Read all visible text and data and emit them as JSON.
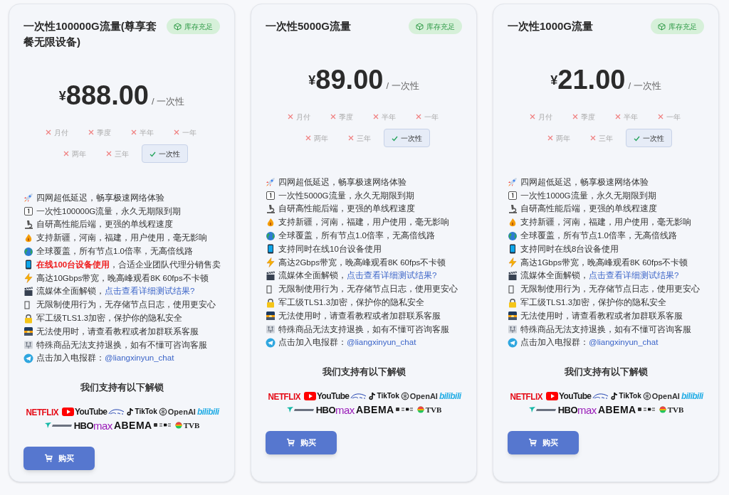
{
  "plans": [
    {
      "title": "一次性100000G流量(尊享套餐无限设备)",
      "stock_badge": "库存充足",
      "currency": "¥",
      "price": "888.00",
      "period_suffix": "/ 一次性",
      "cycles": [
        {
          "label": "月付",
          "selected": false
        },
        {
          "label": "季度",
          "selected": false
        },
        {
          "label": "半年",
          "selected": false
        },
        {
          "label": "一年",
          "selected": false
        },
        {
          "label": "两年",
          "selected": false
        },
        {
          "label": "三年",
          "selected": false
        },
        {
          "label": "一次性",
          "selected": true
        }
      ],
      "features": [
        {
          "kind": "rocket",
          "parts": [
            {
              "kind": "plain",
              "text": "四网超低延迟，畅享极速网络体验"
            }
          ]
        },
        {
          "kind": "keycap",
          "parts": [
            {
              "kind": "plain",
              "text": "一次性100000G流量，永久无期限到期"
            }
          ]
        },
        {
          "kind": "microscope",
          "parts": [
            {
              "kind": "plain",
              "text": "自研高性能后端，更强的单线程速度"
            }
          ]
        },
        {
          "kind": "flame",
          "parts": [
            {
              "kind": "plain",
              "text": "支持新疆，河南，福建，用户使用，毫无影响"
            }
          ]
        },
        {
          "kind": "globe",
          "parts": [
            {
              "kind": "plain",
              "text": "全球覆盖，所有节点1.0倍率，无高倍线路"
            }
          ]
        },
        {
          "kind": "phone",
          "parts": [
            {
              "kind": "alert",
              "text": "在线100台设备使用"
            },
            {
              "kind": "plain",
              "text": "，合适企业团队代理分销售卖"
            }
          ]
        },
        {
          "kind": "bolt",
          "parts": [
            {
              "kind": "plain",
              "text": "高达10Gbps带宽，晚高峰观看8K 60fps不卡顿"
            }
          ]
        },
        {
          "kind": "clapper",
          "parts": [
            {
              "kind": "plain",
              "text": "流媒体全面解锁，"
            },
            {
              "kind": "link",
              "text": "点击查看详细测试结果?"
            }
          ]
        },
        {
          "kind": "missing",
          "parts": [
            {
              "kind": "plain",
              "text": "无限制使用行为，无存储节点日志，使用更安心"
            }
          ]
        },
        {
          "kind": "lock",
          "parts": [
            {
              "kind": "plain",
              "text": "军工级TLS1.3加密，保护你的隐私安全"
            }
          ]
        },
        {
          "kind": "picture",
          "parts": [
            {
              "kind": "plain",
              "text": "无法使用时，请查看教程或者加群联系客服"
            }
          ]
        },
        {
          "kind": "sign",
          "parts": [
            {
              "kind": "plain",
              "text": "特殊商品无法支持退换，如有不懂可咨询客服"
            }
          ]
        },
        {
          "kind": "telegram",
          "parts": [
            {
              "kind": "plain",
              "text": "点击加入电报群："
            },
            {
              "kind": "link",
              "text": "@liangxinyun_chat"
            }
          ]
        }
      ],
      "unlock_heading": "我们支持有以下解锁",
      "logos": [
        {
          "kind": "netflix",
          "text": "NETFLIX"
        },
        {
          "kind": "youtube",
          "text": "YouTube"
        },
        {
          "kind": "disney"
        },
        {
          "kind": "tiktok",
          "text": "TikTok"
        },
        {
          "kind": "openai",
          "text": "OpenAI"
        },
        {
          "kind": "bilibili",
          "text": "bilibili"
        },
        {
          "kind": "bahamut"
        },
        {
          "kind": "hbomax",
          "text": "HBO",
          "text2": "max"
        },
        {
          "kind": "abema",
          "text": "ABEMA"
        },
        {
          "kind": "niconico"
        },
        {
          "kind": "tvb",
          "text": "TVB"
        }
      ],
      "buy_button": "购买"
    },
    {
      "title": "一次性5000G流量",
      "stock_badge": "库存充足",
      "currency": "¥",
      "price": "89.00",
      "period_suffix": "/ 一次性",
      "cycles": [
        {
          "label": "月付",
          "selected": false
        },
        {
          "label": "季度",
          "selected": false
        },
        {
          "label": "半年",
          "selected": false
        },
        {
          "label": "一年",
          "selected": false
        },
        {
          "label": "两年",
          "selected": false
        },
        {
          "label": "三年",
          "selected": false
        },
        {
          "label": "一次性",
          "selected": true
        }
      ],
      "features": [
        {
          "kind": "rocket",
          "parts": [
            {
              "kind": "plain",
              "text": "四网超低延迟，畅享极速网络体验"
            }
          ]
        },
        {
          "kind": "keycap",
          "parts": [
            {
              "kind": "plain",
              "text": "一次性5000G流量，永久无期限到期"
            }
          ]
        },
        {
          "kind": "microscope",
          "parts": [
            {
              "kind": "plain",
              "text": "自研高性能后端，更强的单线程速度"
            }
          ]
        },
        {
          "kind": "flame",
          "parts": [
            {
              "kind": "plain",
              "text": "支持新疆，河南，福建，用户使用，毫无影响"
            }
          ]
        },
        {
          "kind": "globe",
          "parts": [
            {
              "kind": "plain",
              "text": "全球覆盖，所有节点1.0倍率，无高倍线路"
            }
          ]
        },
        {
          "kind": "phone",
          "parts": [
            {
              "kind": "plain",
              "text": "支持同时在线10台设备使用"
            }
          ]
        },
        {
          "kind": "bolt",
          "parts": [
            {
              "kind": "plain",
              "text": "高达2Gbps带宽，晚高峰观看8K 60fps不卡顿"
            }
          ]
        },
        {
          "kind": "clapper",
          "parts": [
            {
              "kind": "plain",
              "text": "流媒体全面解锁，"
            },
            {
              "kind": "link",
              "text": "点击查看详细测试结果?"
            }
          ]
        },
        {
          "kind": "missing",
          "parts": [
            {
              "kind": "plain",
              "text": "无限制使用行为，无存储节点日志，使用更安心"
            }
          ]
        },
        {
          "kind": "lock",
          "parts": [
            {
              "kind": "plain",
              "text": "军工级TLS1.3加密，保护你的隐私安全"
            }
          ]
        },
        {
          "kind": "picture",
          "parts": [
            {
              "kind": "plain",
              "text": "无法使用时，请查看教程或者加群联系客服"
            }
          ]
        },
        {
          "kind": "sign",
          "parts": [
            {
              "kind": "plain",
              "text": "特殊商品无法支持退换，如有不懂可咨询客服"
            }
          ]
        },
        {
          "kind": "telegram",
          "parts": [
            {
              "kind": "plain",
              "text": "点击加入电报群："
            },
            {
              "kind": "link",
              "text": "@liangxinyun_chat"
            }
          ]
        }
      ],
      "unlock_heading": "我们支持有以下解锁",
      "logos": [
        {
          "kind": "netflix",
          "text": "NETFLIX"
        },
        {
          "kind": "youtube",
          "text": "YouTube"
        },
        {
          "kind": "disney"
        },
        {
          "kind": "tiktok",
          "text": "TikTok"
        },
        {
          "kind": "openai",
          "text": "OpenAI"
        },
        {
          "kind": "bilibili",
          "text": "bilibili"
        },
        {
          "kind": "bahamut"
        },
        {
          "kind": "hbomax",
          "text": "HBO",
          "text2": "max"
        },
        {
          "kind": "abema",
          "text": "ABEMA"
        },
        {
          "kind": "niconico"
        },
        {
          "kind": "tvb",
          "text": "TVB"
        }
      ],
      "buy_button": "购买"
    },
    {
      "title": "一次性1000G流量",
      "stock_badge": "库存充足",
      "currency": "¥",
      "price": "21.00",
      "period_suffix": "/ 一次性",
      "cycles": [
        {
          "label": "月付",
          "selected": false
        },
        {
          "label": "季度",
          "selected": false
        },
        {
          "label": "半年",
          "selected": false
        },
        {
          "label": "一年",
          "selected": false
        },
        {
          "label": "两年",
          "selected": false
        },
        {
          "label": "三年",
          "selected": false
        },
        {
          "label": "一次性",
          "selected": true
        }
      ],
      "features": [
        {
          "kind": "rocket",
          "parts": [
            {
              "kind": "plain",
              "text": "四网超低延迟，畅享极速网络体验"
            }
          ]
        },
        {
          "kind": "keycap",
          "parts": [
            {
              "kind": "plain",
              "text": "一次性1000G流量，永久无期限到期"
            }
          ]
        },
        {
          "kind": "microscope",
          "parts": [
            {
              "kind": "plain",
              "text": "自研高性能后端，更强的单线程速度"
            }
          ]
        },
        {
          "kind": "flame",
          "parts": [
            {
              "kind": "plain",
              "text": "支持新疆，河南，福建，用户使用，毫无影响"
            }
          ]
        },
        {
          "kind": "globe",
          "parts": [
            {
              "kind": "plain",
              "text": "全球覆盖，所有节点1.0倍率，无高倍线路"
            }
          ]
        },
        {
          "kind": "phone",
          "parts": [
            {
              "kind": "plain",
              "text": "支持同时在线8台设备使用"
            }
          ]
        },
        {
          "kind": "bolt",
          "parts": [
            {
              "kind": "plain",
              "text": "高达1Gbps带宽，晚高峰观看8K 60fps不卡顿"
            }
          ]
        },
        {
          "kind": "clapper",
          "parts": [
            {
              "kind": "plain",
              "text": "流媒体全面解锁，"
            },
            {
              "kind": "link",
              "text": "点击查看详细测试结果?"
            }
          ]
        },
        {
          "kind": "missing",
          "parts": [
            {
              "kind": "plain",
              "text": "无限制使用行为，无存储节点日志，使用更安心"
            }
          ]
        },
        {
          "kind": "lock",
          "parts": [
            {
              "kind": "plain",
              "text": "军工级TLS1.3加密，保护你的隐私安全"
            }
          ]
        },
        {
          "kind": "picture",
          "parts": [
            {
              "kind": "plain",
              "text": "无法使用时，请查看教程或者加群联系客服"
            }
          ]
        },
        {
          "kind": "sign",
          "parts": [
            {
              "kind": "plain",
              "text": "特殊商品无法支持退换，如有不懂可咨询客服"
            }
          ]
        },
        {
          "kind": "telegram",
          "parts": [
            {
              "kind": "plain",
              "text": "点击加入电报群："
            },
            {
              "kind": "link",
              "text": "@liangxinyun_chat"
            }
          ]
        }
      ],
      "unlock_heading": "我们支持有以下解锁",
      "logos": [
        {
          "kind": "netflix",
          "text": "NETFLIX"
        },
        {
          "kind": "youtube",
          "text": "YouTube"
        },
        {
          "kind": "disney"
        },
        {
          "kind": "tiktok",
          "text": "TikTok"
        },
        {
          "kind": "openai",
          "text": "OpenAI"
        },
        {
          "kind": "bilibili",
          "text": "bilibili"
        },
        {
          "kind": "bahamut"
        },
        {
          "kind": "hbomax",
          "text": "HBO",
          "text2": "max"
        },
        {
          "kind": "abema",
          "text": "ABEMA"
        },
        {
          "kind": "niconico"
        },
        {
          "kind": "tvb",
          "text": "TVB"
        }
      ],
      "buy_button": "购买"
    }
  ]
}
